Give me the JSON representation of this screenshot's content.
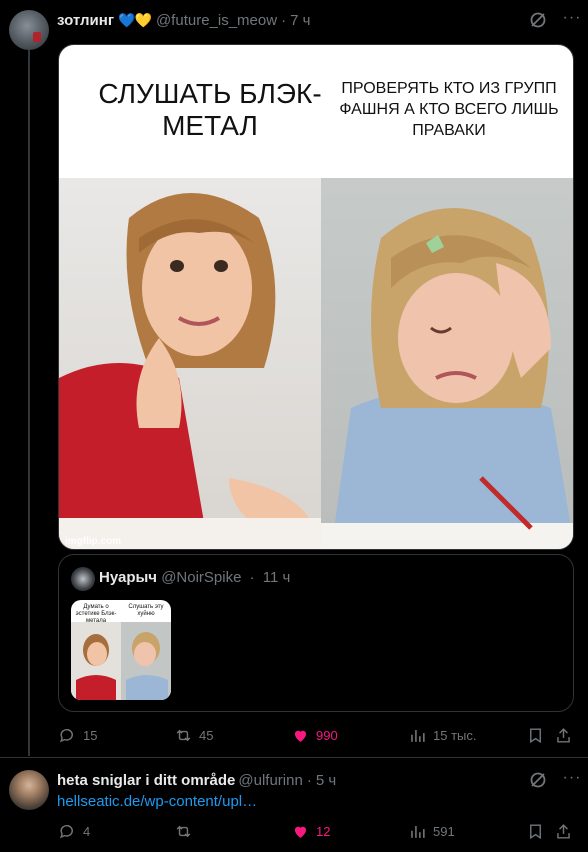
{
  "post1": {
    "author_name": "зотлинг",
    "hearts": [
      "💙",
      "💛"
    ],
    "handle": "@future_is_meow",
    "separator": "·",
    "time": "7 ч",
    "meme": {
      "caption_left": "СЛУШАТЬ БЛЭК-МЕТАЛ",
      "caption_right": "ПРОВЕРЯТЬ КТО ИЗ ГРУПП ФАШНЯ А КТО ВСЕГО ЛИШЬ ПРАВАКИ",
      "watermark": "imgflip.com"
    },
    "quote": {
      "author_name": "Нуарыч",
      "handle": "@NoirSpike",
      "separator": "·",
      "time": "11 ч",
      "thumb_caption_left": "Думать о эстетике Блэк-метала",
      "thumb_caption_right": "Слушать эту хуйню"
    },
    "actions": {
      "replies": "15",
      "reposts": "45",
      "likes": "990",
      "views": "15 тыс."
    }
  },
  "post2": {
    "author_name": "heta sniglar i ditt område",
    "handle": "@ulfurinn",
    "separator": "·",
    "time": "5 ч",
    "link_text": "hellseatic.de/wp-content/upl…",
    "actions": {
      "replies": "4",
      "reposts": "",
      "likes": "12",
      "views": "591"
    }
  },
  "colors": {
    "background": "#000000",
    "text_primary": "#e7e9ea",
    "text_secondary": "#71767b",
    "like_pink": "#f91880",
    "link_blue": "#1d9bf0",
    "border": "#2f3336"
  },
  "icons": [
    "grok-icon",
    "more-icon",
    "reply-icon",
    "repost-icon",
    "like-icon",
    "views-icon",
    "bookmark-icon",
    "share-icon"
  ]
}
